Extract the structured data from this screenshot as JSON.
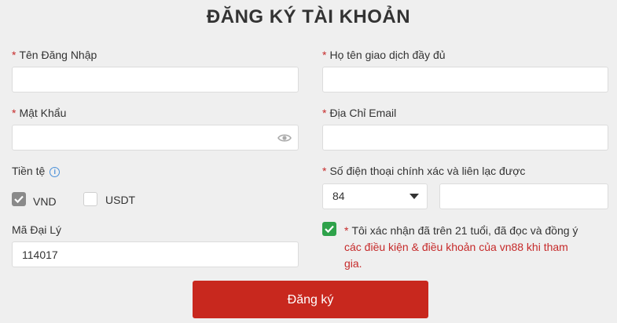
{
  "page": {
    "title": "ĐĂNG KÝ TÀI KHOẢN"
  },
  "form": {
    "username": {
      "required_mark": "*",
      "label": "Tên Đăng Nhập",
      "value": ""
    },
    "fullname": {
      "required_mark": "*",
      "label": "Họ tên giao dịch đầy đủ",
      "value": ""
    },
    "password": {
      "required_mark": "*",
      "label": "Mật Khẩu",
      "value": "",
      "toggle_icon": "eye-icon"
    },
    "email": {
      "required_mark": "*",
      "label": "Địa Chỉ Email",
      "value": ""
    },
    "currency": {
      "label": "Tiền tệ",
      "info_icon": "info-icon",
      "options": [
        {
          "label": "VND",
          "checked": true
        },
        {
          "label": "USDT",
          "checked": false
        }
      ]
    },
    "phone": {
      "required_mark": "*",
      "label": "Số điện thoại chính xác và liên lạc được",
      "country_code": "84",
      "value": ""
    },
    "agent_code": {
      "label": "Mã Đại Lý",
      "value": "114017"
    },
    "agreement": {
      "checked": true,
      "required_mark": "*",
      "text": "Tôi xác nhận đã trên 21 tuổi, đã đọc và đồng ý",
      "link_text": "các điều kiện & điều khoản của vn88 khi tham gia."
    },
    "submit_label": "Đăng ký"
  },
  "colors": {
    "background": "#efefef",
    "required": "#c62a2a",
    "button": "#c8281e",
    "checkbox_checked_green": "#2ea24a",
    "checkbox_checked_grey": "#8a8a8a",
    "info_blue": "#4a90d9"
  }
}
